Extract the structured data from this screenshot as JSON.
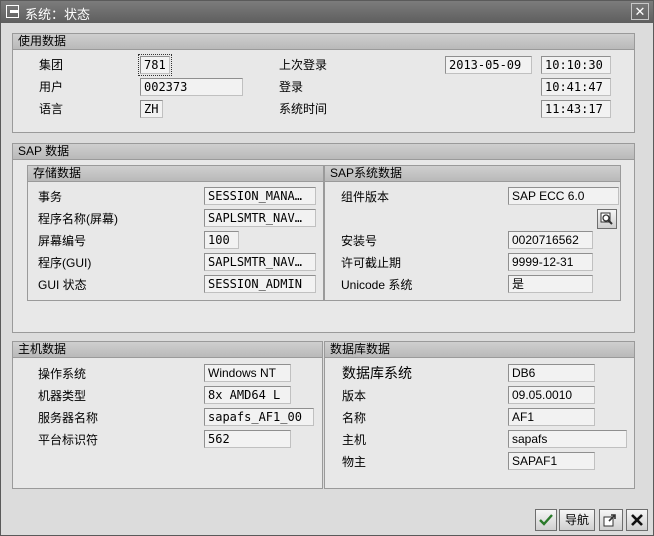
{
  "window": {
    "title": "系统：状态"
  },
  "usage": {
    "title": "使用数据",
    "client_label": "集团",
    "client": "781",
    "user_label": "用户",
    "user": "002373",
    "language_label": "语言",
    "language": "ZH",
    "last_login_label": "上次登录",
    "last_login_date": "2013-05-09",
    "last_login_time": "10:10:30",
    "login_label": "登录",
    "login_time": "10:41:47",
    "system_time_label": "系统时间",
    "system_time": "11:43:17"
  },
  "sap": {
    "title": "SAP 数据",
    "storage": {
      "title": "存储数据",
      "transaction_label": "事务",
      "transaction": "SESSION_MANA…",
      "program_screen_label": "程序名称(屏幕)",
      "program_screen": "SAPLSMTR_NAV…",
      "screen_number_label": "屏幕编号",
      "screen_number": "100",
      "program_gui_label": "程序(GUI)",
      "program_gui": "SAPLSMTR_NAV…",
      "gui_status_label": "GUI 状态",
      "gui_status": "SESSION_ADMIN"
    },
    "system": {
      "title": "SAP系统数据",
      "component_label": "组件版本",
      "component": "SAP ECC 6.0",
      "installation_label": "安装号",
      "installation": "0020716562",
      "license_expiry_label": "许可截止期",
      "license_expiry": "9999-12-31",
      "unicode_label": "Unicode 系统",
      "unicode": "是"
    }
  },
  "host": {
    "title": "主机数据",
    "os_label": "操作系统",
    "os": "Windows NT",
    "machine_label": "机器类型",
    "machine": "8x AMD64 L",
    "server_label": "服务器名称",
    "server": "sapafs_AF1_00",
    "platform_label": "平台标识符",
    "platform": "562"
  },
  "database": {
    "title": "数据库数据",
    "db_system_label": "数据库系统",
    "db_system": "DB6",
    "version_label": "版本",
    "version": "09.05.0010",
    "name_label": "名称",
    "name": "AF1",
    "host_label": "主机",
    "host": "sapafs",
    "owner_label": "物主",
    "owner": "SAPAF1"
  },
  "buttons": {
    "navigate_label": "导航"
  },
  "colors": {
    "titlebar": "#6e6e6e",
    "group_header": "#c4c4c4",
    "check_green": "#2a7a2a",
    "cancel_red": "#111111"
  }
}
